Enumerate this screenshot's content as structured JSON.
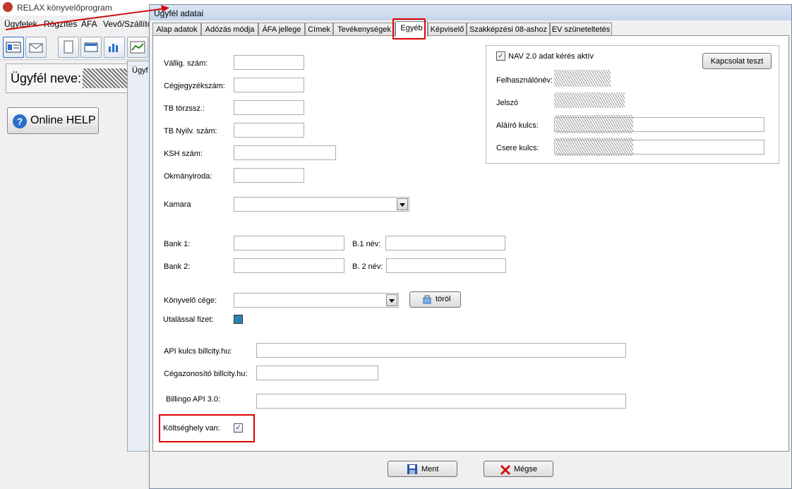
{
  "app": {
    "title": "RELAX könyvelőprogram",
    "menu": [
      "Ügyfelek",
      "Rögzítés",
      "ÁFA",
      "Vevő/Szállító"
    ],
    "client_name_label": "Ügyfél neve:",
    "online_help": "Online HELP",
    "bg_window_title": "Ügyf"
  },
  "dialog": {
    "title": "Ügyfél adatai",
    "tabs": [
      "Alap adatok",
      "Adózás módja",
      "ÁFA jellege",
      "Címek",
      "Tevékenységek",
      "Egyéb",
      "Képviselő",
      "Szakképzési 08-ashoz",
      "EV szüneteltetés"
    ],
    "active_tab": "Egyéb"
  },
  "form": {
    "vallig_szam": {
      "label": "Vállig. szám:",
      "value": ""
    },
    "cegjegyzekszam": {
      "label": "Cégjegyzékszám:",
      "value": ""
    },
    "tb_torzssz": {
      "label": "TB törzssz.:",
      "value": ""
    },
    "tb_nyilv_szam": {
      "label": "TB Nyilv. szám:",
      "value": ""
    },
    "ksh_szam": {
      "label": "KSH szám:",
      "value": ""
    },
    "okmanyiroda": {
      "label": "Okmányiroda:",
      "value": ""
    },
    "kamara": {
      "label": "Kamara",
      "value": ""
    },
    "bank1": {
      "label": "Bank 1:",
      "value": ""
    },
    "b1_nev": {
      "label": "B.1 név:",
      "value": ""
    },
    "bank2": {
      "label": "Bank 2:",
      "value": ""
    },
    "b2_nev": {
      "label": "B. 2 név:",
      "value": ""
    },
    "konyvelo_cege": {
      "label": "Könyvelő cége:",
      "value": ""
    },
    "torol_button": "töröl",
    "utalassal_fizet": {
      "label": "Utalással fizet:",
      "checked": false
    },
    "api_kulcs": {
      "label": "API kulcs billcity.hu:",
      "value": ""
    },
    "cegazonosito": {
      "label": "Cégazonosító billcity.hu:",
      "value": ""
    },
    "billingo": {
      "label": "Billingo API 3.0:",
      "value": ""
    },
    "koltseghely": {
      "label": "Költséghely van:",
      "checked": true
    }
  },
  "nav": {
    "checkbox_label": "NAV 2.0 adat kérés aktív",
    "checked": true,
    "test_button": "Kapcsolat teszt",
    "username_label": "Felhasználónév:",
    "password_label": "Jelszó",
    "signing_key_label": "Aláíró kulcs:",
    "exchange_key_label": "Csere kulcs:"
  },
  "buttons": {
    "save": "Ment",
    "cancel": "Mégse"
  },
  "colors": {
    "highlight": "#dd0000",
    "accent": "#23439a"
  }
}
